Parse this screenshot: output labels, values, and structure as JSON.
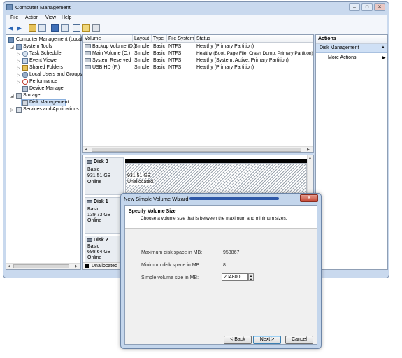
{
  "window": {
    "title": "Computer Management",
    "controls": {
      "minimize": "–",
      "maximize": "□",
      "close": "✕"
    }
  },
  "menu": [
    "File",
    "Action",
    "View",
    "Help"
  ],
  "tree": [
    {
      "label": "Computer Management (Local",
      "icon": "computer-icon"
    },
    {
      "label": "System Tools",
      "icon": "tools-icon"
    },
    {
      "label": "Task Scheduler",
      "icon": "clock-icon"
    },
    {
      "label": "Event Viewer",
      "icon": "event-viewer-icon"
    },
    {
      "label": "Shared Folders",
      "icon": "folder-icon"
    },
    {
      "label": "Local Users and Groups",
      "icon": "users-icon"
    },
    {
      "label": "Performance",
      "icon": "performance-icon"
    },
    {
      "label": "Device Manager",
      "icon": "device-manager-icon"
    },
    {
      "label": "Storage",
      "icon": "storage-icon"
    },
    {
      "label": "Disk Management",
      "icon": "disk-management-icon"
    },
    {
      "label": "Services and Applications",
      "icon": "services-icon"
    }
  ],
  "volumes": {
    "columns": [
      "Volume",
      "Layout",
      "Type",
      "File System",
      "Status"
    ],
    "rows": [
      [
        "Backup Volume (D:)",
        "Simple",
        "Basic",
        "NTFS",
        "Healthy (Primary Partition)"
      ],
      [
        "Main Volume (C:)",
        "Simple",
        "Basic",
        "NTFS",
        "Healthy (Boot, Page File, Crash Dump, Primary Partition)"
      ],
      [
        "System Reserved",
        "Simple",
        "Basic",
        "NTFS",
        "Healthy (System, Active, Primary Partition)"
      ],
      [
        "USB HD (F:)",
        "Simple",
        "Basic",
        "NTFS",
        "Healthy (Primary Partition)"
      ]
    ]
  },
  "disks": [
    {
      "name": "Disk 0",
      "type": "Basic",
      "size": "931.51 GB",
      "status": "Online",
      "part_size": "931.51 GB",
      "part_label": "Unallocated"
    },
    {
      "name": "Disk 1",
      "type": "Basic",
      "size": "139.73 GB",
      "status": "Online"
    },
    {
      "name": "Disk 2",
      "type": "Basic",
      "size": "698.64 GB",
      "status": "Online"
    }
  ],
  "legend": {
    "unallocated": "Unallocated"
  },
  "actions": {
    "header": "Actions",
    "section": "Disk Management",
    "more": "More Actions"
  },
  "wizard": {
    "title": "New Simple Volume Wizard",
    "heading": "Specify Volume Size",
    "subheading": "Choose a volume size that is between the maximum and minimum sizes.",
    "max_label": "Maximum disk space in MB:",
    "max_value": "953867",
    "min_label": "Minimum disk space in MB:",
    "min_value": "8",
    "size_label": "Simple volume size in MB:",
    "size_value": "204800",
    "back": "< Back",
    "next": "Next >",
    "cancel": "Cancel",
    "close": "✕"
  },
  "colors": {
    "accent": "#3a78c4",
    "title_selection": "#cfe0f5",
    "dialog_header": "#2e58a8"
  }
}
